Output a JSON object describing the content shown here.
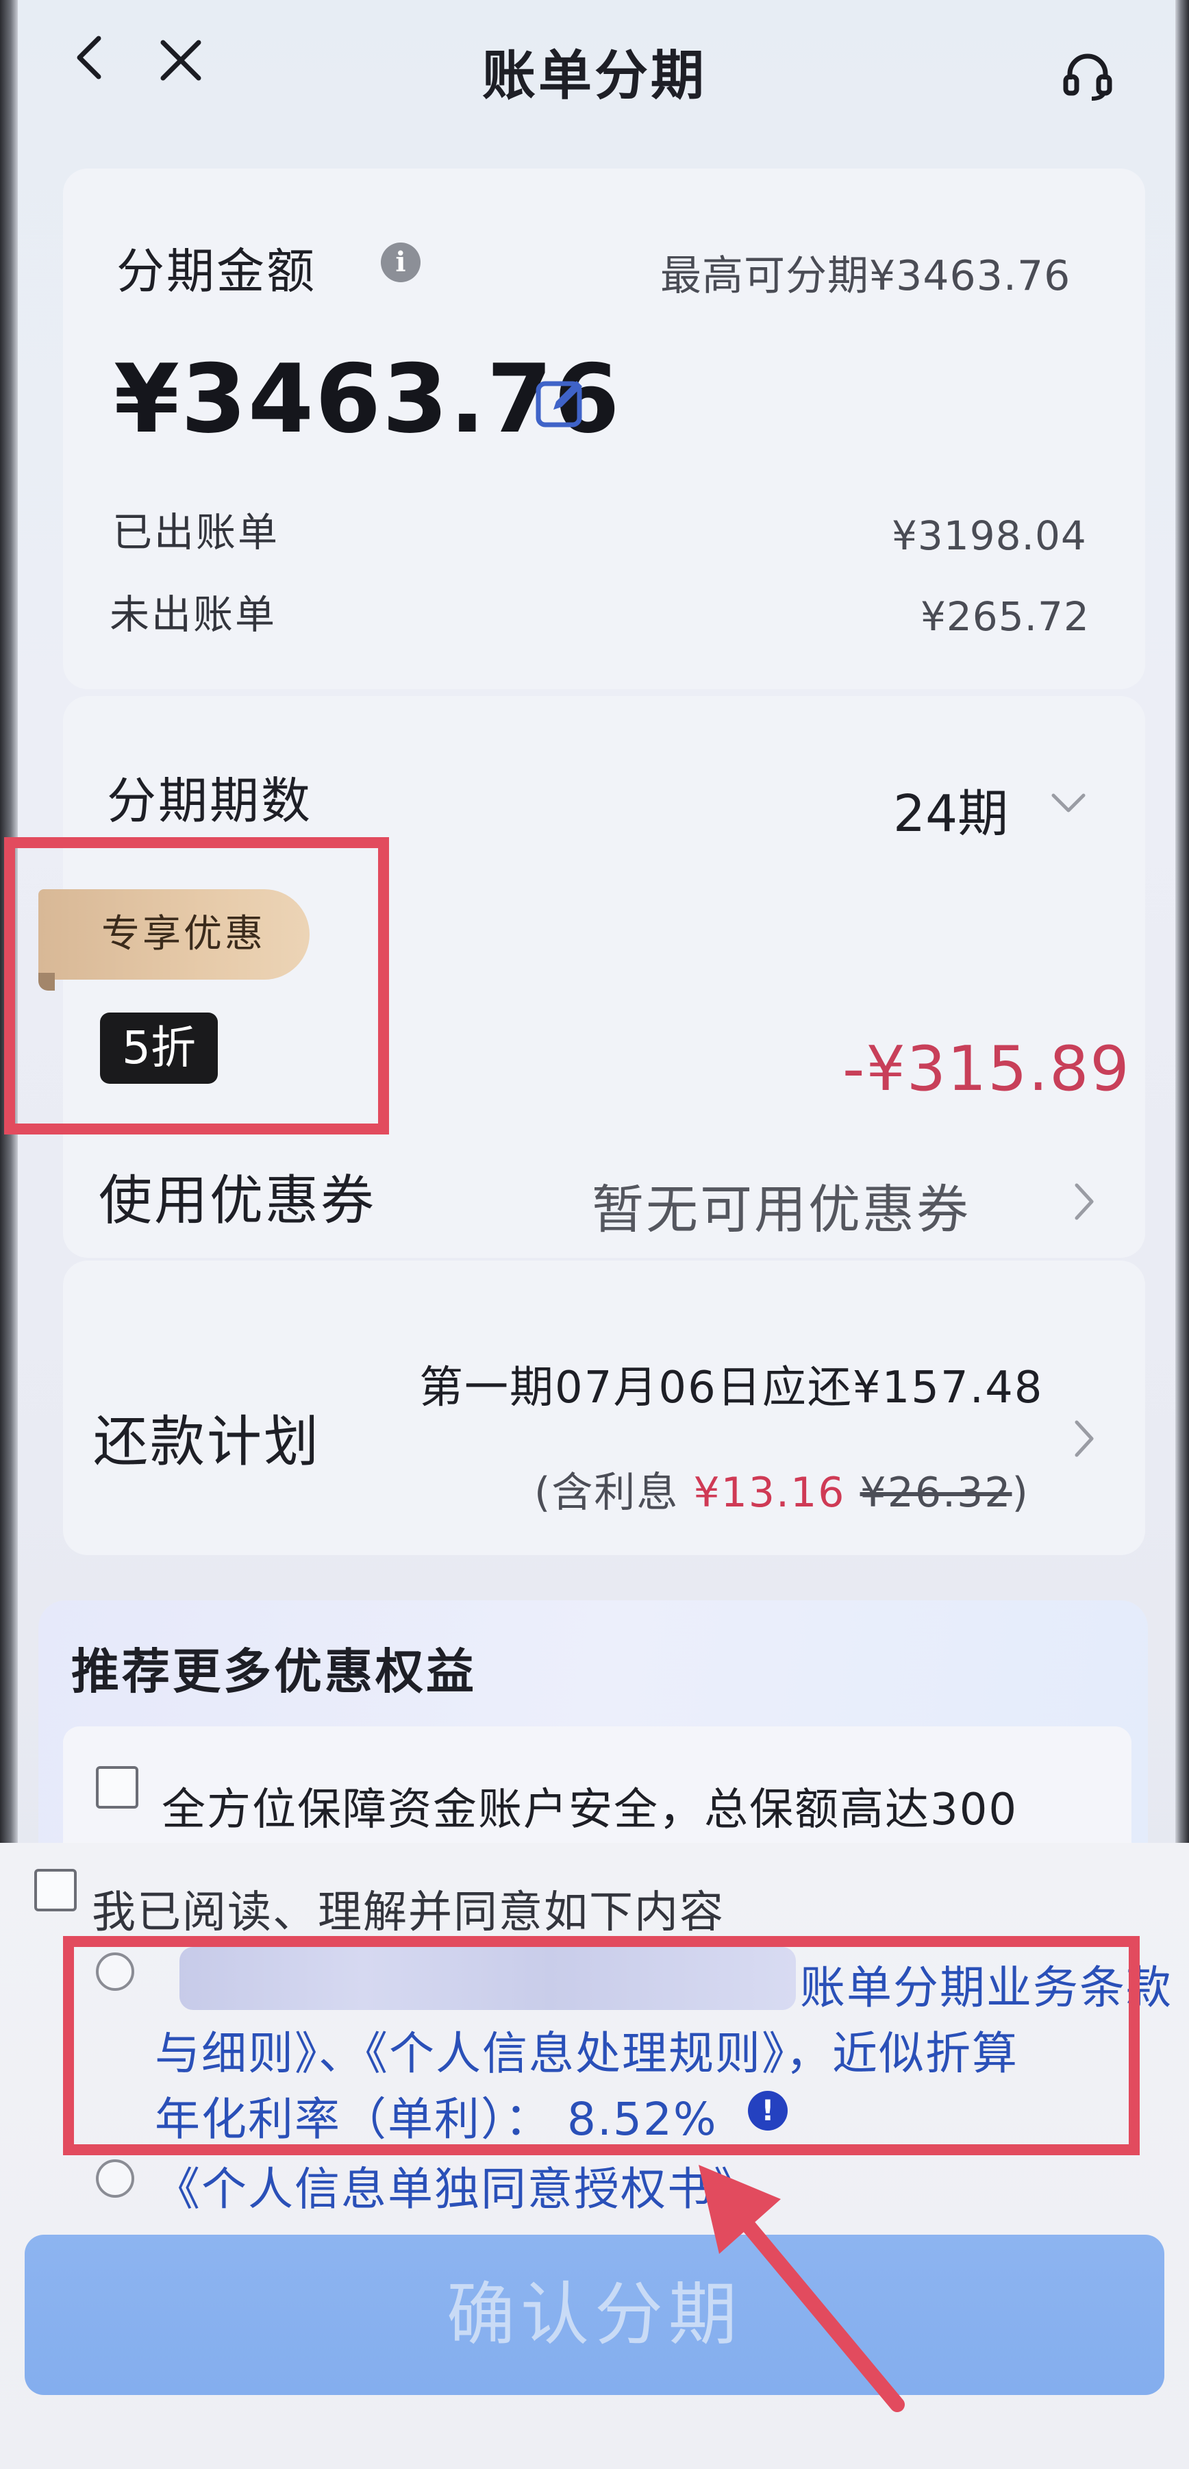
{
  "header": {
    "title": "账单分期",
    "back_icon": "chevron-left",
    "close_icon": "close-x",
    "support_icon": "headset"
  },
  "amount_section": {
    "label": "分期金额",
    "max_hint": "最高可分期¥3463.76",
    "amount": "¥3463.76",
    "billed_label": "已出账单",
    "billed_value": "¥3198.04",
    "unbilled_label": "未出账单",
    "unbilled_value": "¥265.72"
  },
  "installment": {
    "label": "分期期数",
    "selected": "24期"
  },
  "promotion": {
    "tag": "专享优惠",
    "badge": "5折",
    "discount": "-¥315.89"
  },
  "coupon": {
    "label": "使用优惠券",
    "value": "暂无可用优惠券"
  },
  "repayment": {
    "label": "还款计划",
    "first_period": "第一期07月06日应还¥157.48",
    "interest_prefix": "(含利息",
    "interest_now": "¥13.16",
    "interest_original": "¥26.32",
    "interest_suffix": ")"
  },
  "recommend": {
    "title": "推荐更多优惠权益",
    "item": "全方位保障资金账户安全，总保额高达300"
  },
  "agreement": {
    "label": "我已阅读、理解并同意如下内容",
    "line1_tail": "账单分期业务条款",
    "line2": "与细则》、《个人信息处理规则》，近似折算",
    "line3": "年化利率（单利）： 8.52%",
    "line4": "《个人信息单独同意授权书》"
  },
  "confirm_button": "确认分期",
  "colors": {
    "accent_blue": "#2a50b8",
    "discount_red": "#c83f59",
    "highlight_box": "#e24b5e",
    "button": "#8db4f0"
  }
}
